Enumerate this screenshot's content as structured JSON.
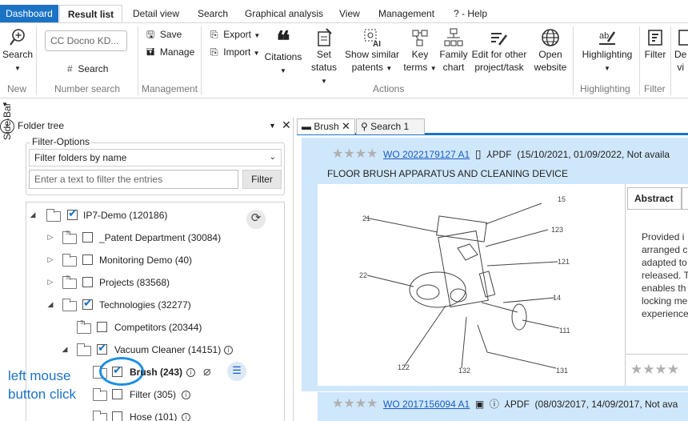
{
  "menu": {
    "tabs": [
      "Dashboard",
      "Result list",
      "Detail view",
      "Search",
      "Graphical analysis",
      "View",
      "Management",
      "? - Help"
    ]
  },
  "ribbon": {
    "search_label": "Search",
    "cc_placeholder": "CC Docno KD...",
    "number_search_label": "Search",
    "save": "Save",
    "manage": "Manage",
    "export": "Export",
    "import": "Import",
    "citations": "Citations",
    "set_status_1": "Set",
    "set_status_2": "status",
    "show_similar_1": "Show similar",
    "show_similar_2": "patents",
    "key_terms_1": "Key",
    "key_terms_2": "terms",
    "family_chart_1": "Family",
    "family_chart_2": "chart",
    "edit_other_1": "Edit for other",
    "edit_other_2": "project/task",
    "open_website_1": "Open",
    "open_website_2": "website",
    "highlighting": "Highlighting",
    "filter": "Filter",
    "de_1": "De",
    "de_2": "vi",
    "groups": {
      "new": "New",
      "number_search": "Number search",
      "management": "Management",
      "actions": "Actions",
      "highlighting": "Highlighting",
      "filter": "Filter"
    }
  },
  "sidebar": {
    "label": "Side-Bar"
  },
  "folder_panel": {
    "title": "Folder tree",
    "filter_options_legend": "Filter-Options",
    "select_value": "Filter folders by name",
    "filter_placeholder": "Enter a text to filter the entries",
    "filter_button": "Filter",
    "nodes": [
      {
        "label": "IP7-Demo (120186)"
      },
      {
        "label": "_Patent Department (30084)"
      },
      {
        "label": "Monitoring Demo (40)"
      },
      {
        "label": "Projects (83568)"
      },
      {
        "label": "Technologies (32277)"
      },
      {
        "label": "Competitors (20344)"
      },
      {
        "label": "Vacuum Cleaner (14151)"
      },
      {
        "label": "Brush (243)"
      },
      {
        "label": "Filter (305)"
      },
      {
        "label": "Hose (101)"
      }
    ]
  },
  "annotation": {
    "line1": "left mouse",
    "line2": "button click"
  },
  "results": {
    "tabs": [
      "Brush",
      "Search 1"
    ],
    "card1": {
      "number": "WO 2022179127 A1",
      "pdf": "PDF",
      "dates": "(15/10/2021, 01/09/2022, Not availa",
      "title": "FLOOR BRUSH APPARATUS AND CLEANING DEVICE",
      "abstract_tab": "Abstract",
      "abstract_lines": [
        "Provided i",
        "arranged c",
        "adapted to",
        "released. T",
        "enables th",
        "locking me",
        "experience"
      ],
      "figure_labels": [
        "15",
        "21",
        "123",
        "121",
        "22",
        "14",
        "111",
        "122",
        "132",
        "131"
      ]
    },
    "card2": {
      "number": "WO 2017156094 A1",
      "pdf": "PDF",
      "dates": "(08/03/2017, 14/09/2017, Not ava"
    }
  },
  "colors": {
    "accent": "#1b73c6",
    "card_bg": "#cfe7fb"
  }
}
